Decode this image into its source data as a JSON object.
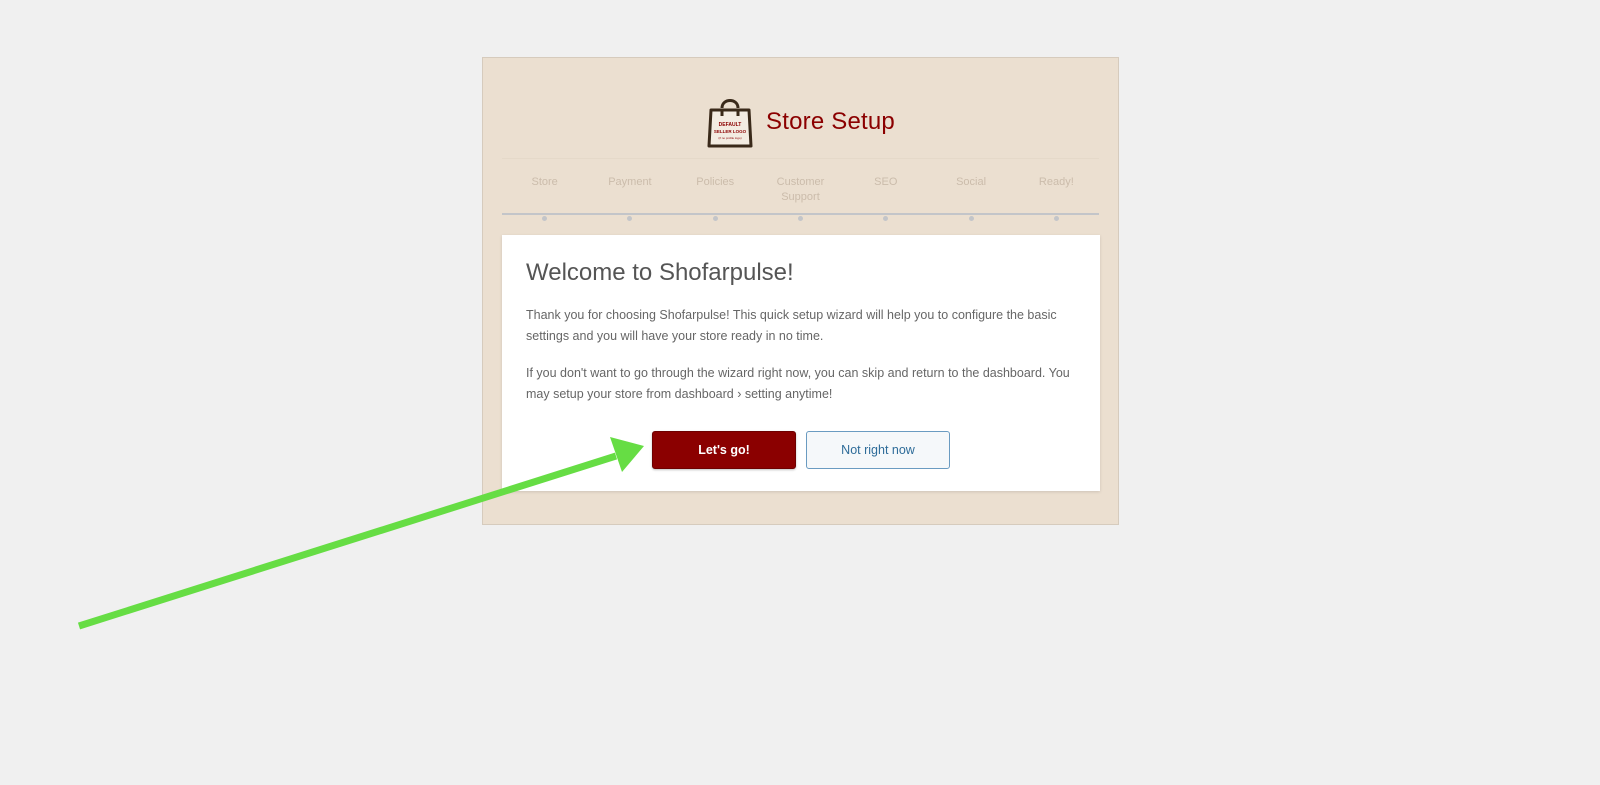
{
  "wizard": {
    "title": "Store Setup",
    "logo": {
      "icon": "shopping-bag-icon",
      "line1": "DEFAULT",
      "line2": "SELLER LOGO",
      "line3": "(if no profile logo)"
    },
    "steps": [
      {
        "label": "Store"
      },
      {
        "label": "Payment"
      },
      {
        "label": "Policies"
      },
      {
        "label": "Customer Support"
      },
      {
        "label": "SEO"
      },
      {
        "label": "Social"
      },
      {
        "label": "Ready!"
      }
    ]
  },
  "welcome": {
    "heading": "Welcome to Shofarpulse!",
    "paragraph1": "Thank you for choosing Shofarpulse! This quick setup wizard will help you to configure the basic settings and you will have your store ready in no time.",
    "paragraph2": "If you don't want to go through the wizard right now, you can skip and return to the dashboard. You may setup your store from dashboard › setting anytime!",
    "primary_button": "Let's go!",
    "secondary_button": "Not right now"
  },
  "colors": {
    "brand": "#8b0000",
    "frame_background": "#ebdfd0",
    "page_background": "#f0f0f0",
    "annotation_arrow": "#66dd44"
  }
}
